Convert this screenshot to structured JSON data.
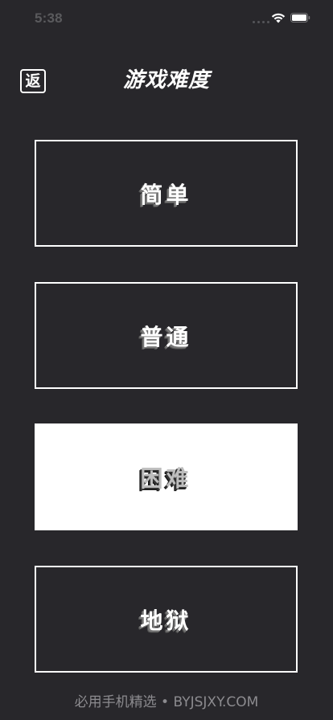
{
  "status_bar": {
    "time": "5:38",
    "icons": [
      "cellular-dots-icon",
      "wifi-icon",
      "battery-icon"
    ]
  },
  "header": {
    "back_label": "返",
    "title": "游戏难度"
  },
  "difficulties": [
    {
      "label": "简单",
      "selected": false
    },
    {
      "label": "普通",
      "selected": false
    },
    {
      "label": "困难",
      "selected": true
    },
    {
      "label": "地狱",
      "selected": false
    }
  ],
  "watermark": "必用手机精选 • BYJSJXY.COM",
  "colors": {
    "background": "#28272b",
    "foreground": "#ffffff",
    "selected_fill": "#ffffff"
  }
}
